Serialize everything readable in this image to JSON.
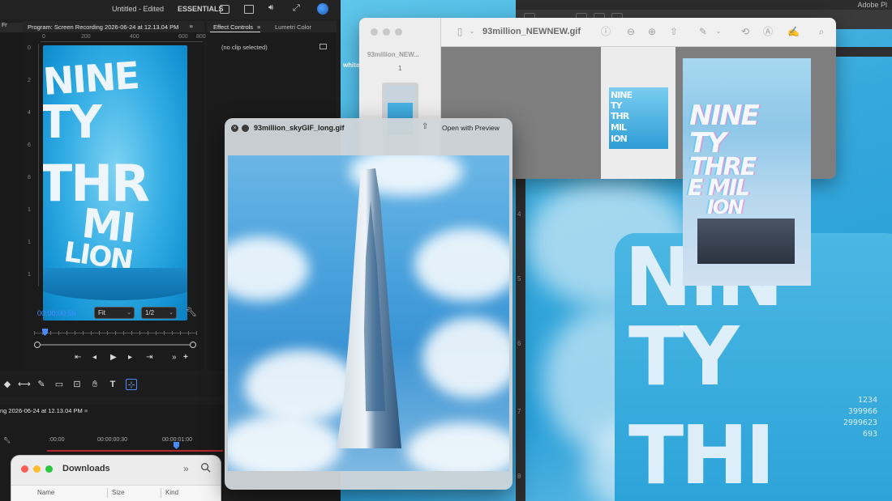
{
  "premiere": {
    "document_title": "Untitled",
    "document_status": "- Edited",
    "workspace": "ESSENTIALS",
    "left_strip_tab": "Fr",
    "program_tab": "Program: Screen Recording 2026-06-24 at 12.13.04 PM",
    "ruler_marks": [
      "0",
      "200",
      "400",
      "600",
      "800"
    ],
    "vruler_marks": [
      "0",
      "2",
      "4",
      "6",
      "8",
      "1",
      "1",
      "1"
    ],
    "timecode": "00:00:00:59",
    "fit_select": "Fit",
    "resolution_select": "1/2",
    "effect_controls_tab": "Effect Controls",
    "lumetri_tab": "Lumetri Color",
    "no_clip": "(no clip selected)",
    "sequence_title": "ng 2026-06-24 at 12.13.04 PM",
    "timeline_times": [
      ":00:00",
      "00:00:00:30",
      "00:00:01:00"
    ],
    "preview_words": [
      "NINE",
      "TY",
      "THR",
      "MI",
      "LION"
    ]
  },
  "finder": {
    "title": "Downloads",
    "columns": [
      "Name",
      "Size",
      "Kind"
    ]
  },
  "preview_app": {
    "title": "93million_NEWNEW.gif",
    "sidebar_label": "93million_NEW...",
    "page_number": "1",
    "partial_white_text": "white",
    "thumb_words": [
      "NINE",
      "TY",
      "THR",
      "MIL",
      "ION"
    ]
  },
  "holo_words": [
    "NINE",
    "TY",
    "THRE",
    "E MIL",
    "ION"
  ],
  "quicklook": {
    "title": "93million_skyGIF_long.gif",
    "open_button": "Open with Preview"
  },
  "adobe": {
    "app_title": "Adobe Pl",
    "ruler_marks": [
      "4",
      "5",
      "6",
      "7",
      "8"
    ],
    "bg_words": [
      "NIN",
      "TY",
      "THI"
    ],
    "bg_digits": [
      "1234",
      "399966",
      "2999623",
      "693"
    ]
  },
  "colors": {
    "accent_blue": "#4a8cff",
    "art_cyan": "#2aa0d9",
    "timeline_red": "#b7262a"
  }
}
